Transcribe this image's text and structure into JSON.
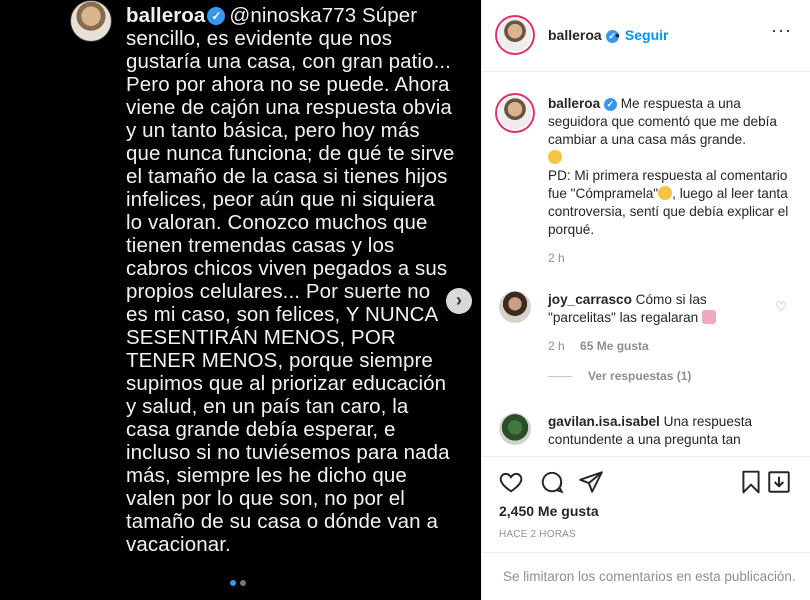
{
  "media": {
    "author": "balleroa",
    "text": "@ninoska773 Súper sencillo, es evidente que nos gustaría una casa, con gran patio... Pero por ahora no se puede. Ahora viene de cajón una respuesta obvia y un tanto básica, pero hoy más que nunca funciona; de qué te sirve el tamaño de la casa si tienes hijos infelices, peor aún que ni siquiera lo valoran. Conozco muchos que tienen tremendas casas y los cabros chicos viven pegados a sus propios celulares... Por suerte no es mi caso, son felices, Y NUNCA SESENTIRÁN MENOS, POR TENER MENOS, porque siempre supimos que al priorizar educación y salud, en un país tan caro, la casa grande debía esperar, e incluso si no tuviésemos para nada más, siempre les he dicho que valen por lo que son, no por el tamaño de su casa o dónde van a vacacionar."
  },
  "header": {
    "username": "balleroa",
    "separator": "•",
    "follow_label": "Seguir"
  },
  "caption": {
    "username": "balleroa",
    "text_1": "Me respuesta a una seguidora que comentó que me debía cambiar a una casa más grande.",
    "text_2": "PD: Mi primera respuesta al comentario fue \"Cómpramela\"",
    "text_3": ", luego al leer tanta controversia, sentí que debía explicar el porqué.",
    "time": "2 h"
  },
  "comments": [
    {
      "username": "joy_carrasco",
      "text": "Cómo si las \"parcelitas\" las regalaran",
      "time": "2 h",
      "likes": "65 Me gusta",
      "replies": "Ver respuestas (1)"
    },
    {
      "username": "gavilan.isa.isabel",
      "text": "Una respuesta contundente a una pregunta tan"
    }
  ],
  "actions": {
    "likes": "2,450 Me gusta",
    "timestamp": "HACE 2 HORAS"
  },
  "footer": {
    "notice": "Se limitaron los comentarios en esta publicación."
  },
  "colors": {
    "accent": "#0095f6",
    "verified": "#3897f0"
  }
}
